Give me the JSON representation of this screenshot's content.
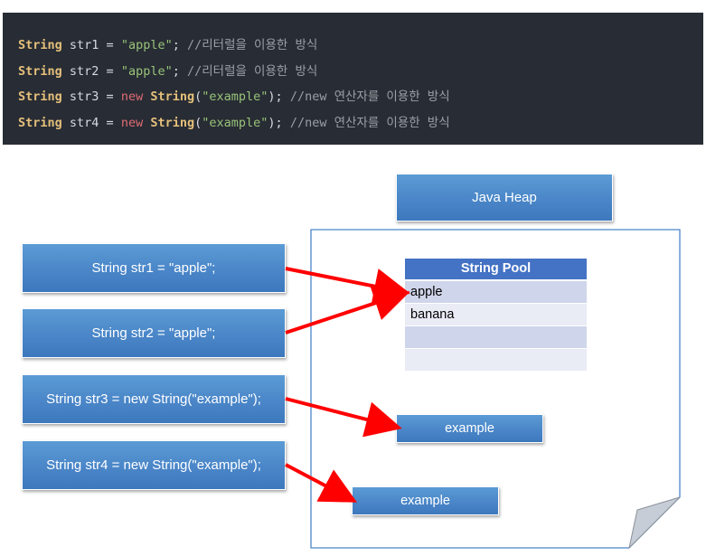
{
  "code_lines": [
    {
      "type_kw": "String",
      "decl": " str1 = ",
      "value": "\"apple\"",
      "end": ";",
      "comment": " //리터럴을 이용한 방식"
    },
    {
      "type_kw": "String",
      "decl": " str2 = ",
      "value": "\"apple\"",
      "end": ";",
      "comment": " //리터럴을 이용한 방식"
    },
    {
      "type_kw": "String",
      "decl": " str3 = ",
      "new_kw": "new",
      "ctor": "String",
      "paren_open": "(",
      "value": "\"example\"",
      "end": ");",
      "comment": " //new 연산자를 이용한 방식"
    },
    {
      "type_kw": "String",
      "decl": " str4 = ",
      "new_kw": "new",
      "ctor": "String",
      "paren_open": "(",
      "value": "\"example\"",
      "end": ");",
      "comment": " //new 연산자를 이용한 방식"
    }
  ],
  "diagram": {
    "heap_label": "Java Heap",
    "variables": [
      "String str1 = \"apple\";",
      "String str2 = \"apple\";",
      "String str3 = new String(\"example\");",
      "String str4 = new String(\"example\");"
    ],
    "string_pool": {
      "title": "String Pool",
      "rows": [
        "apple",
        "banana",
        "",
        ""
      ]
    },
    "objects": [
      "example",
      "example"
    ]
  },
  "colors": {
    "code_bg": "#282c34",
    "box_fill": "#4a86c8",
    "pool_header": "#4472c4",
    "arrow": "#ff0000"
  }
}
